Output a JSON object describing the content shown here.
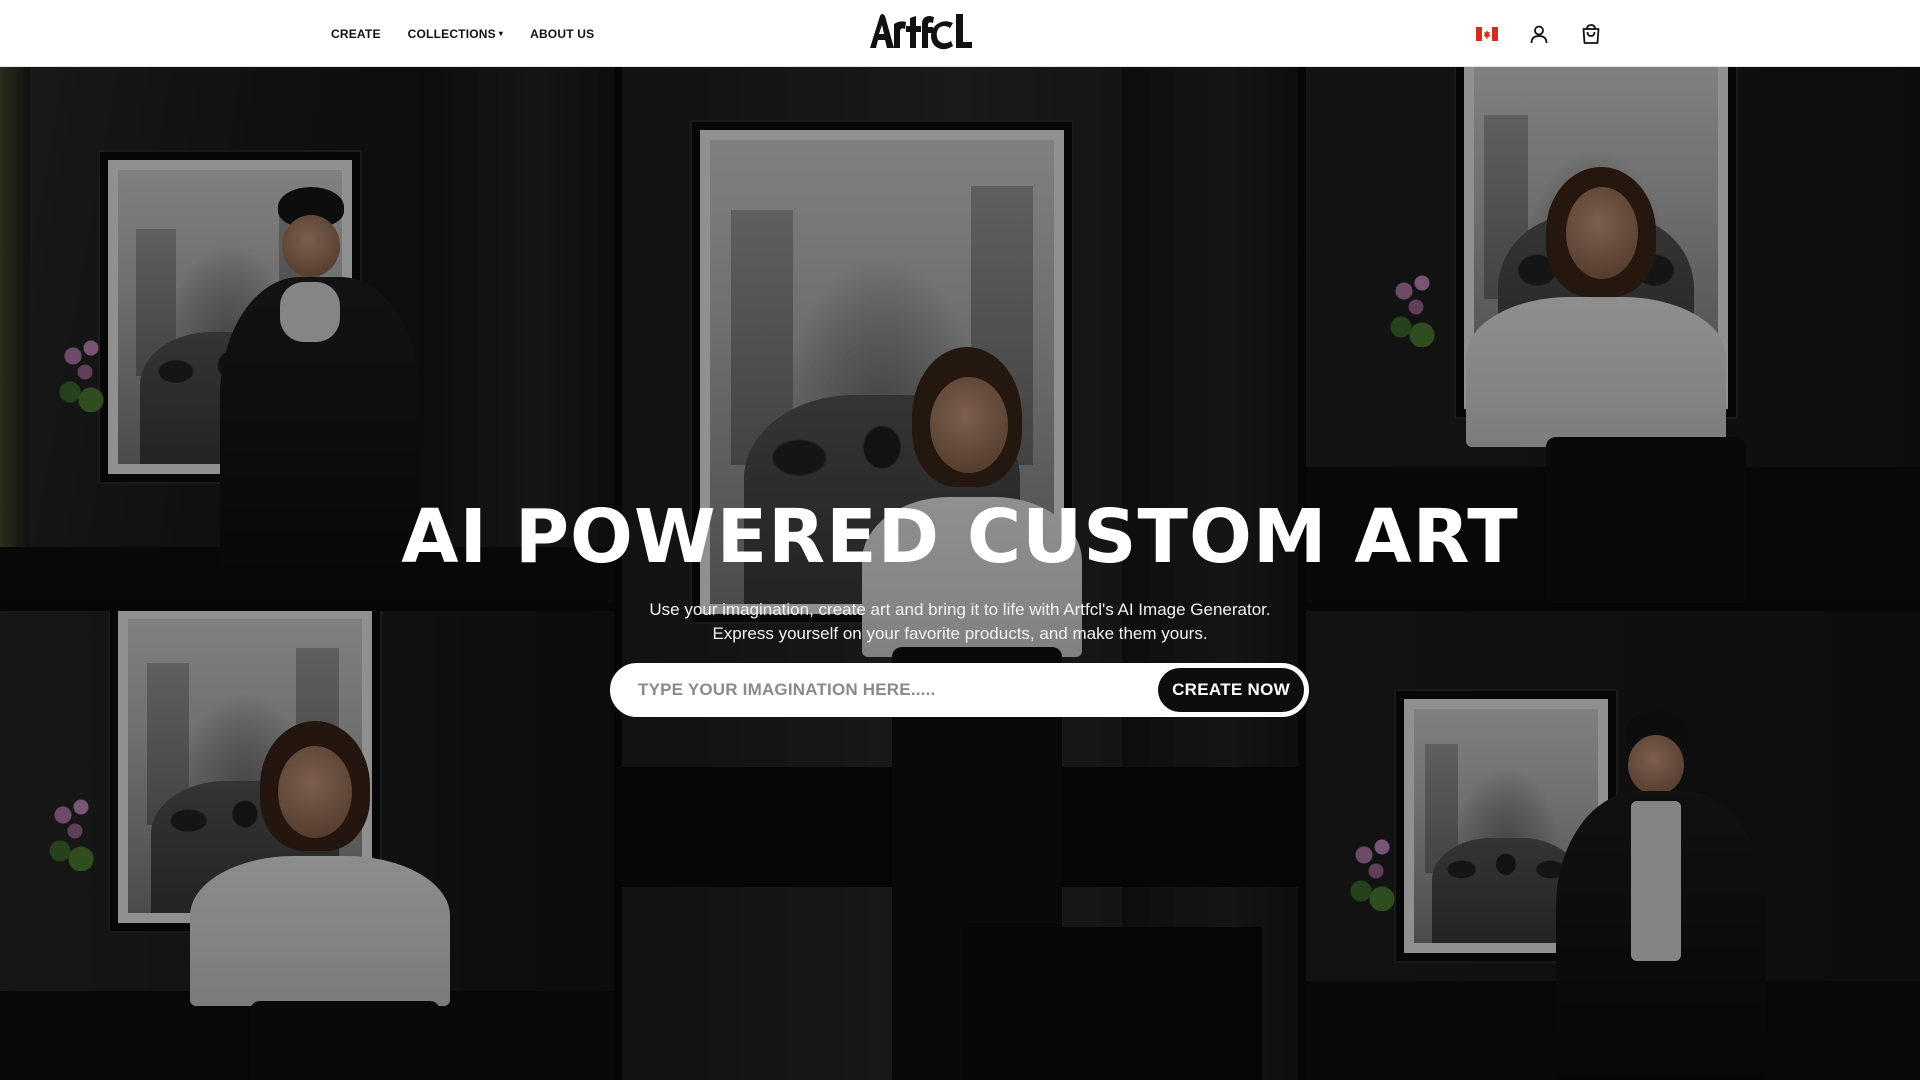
{
  "header": {
    "nav": [
      {
        "label": "CREATE",
        "has_dropdown": false
      },
      {
        "label": "COLLECTIONS",
        "has_dropdown": true
      },
      {
        "label": "ABOUT US",
        "has_dropdown": false
      }
    ],
    "logo_text": "Artfcl",
    "icons": [
      "canada-flag-icon",
      "account-icon",
      "cart-icon"
    ]
  },
  "hero": {
    "headline": "AI POWERED CUSTOM ART",
    "subtitle_line1": "Use your imagination, create art and bring it to life with Artfcl's AI Image Generator.",
    "subtitle_line2": "Express yourself on your favorite products, and make them yours.",
    "search": {
      "placeholder": "TYPE YOUR IMAGINATION HERE.....",
      "value": ""
    },
    "cta_label": "CREATE NOW"
  },
  "colors": {
    "header_bg": "#ffffff",
    "text_dark": "#111111",
    "cta_bg": "#0d0d0d",
    "flag_red": "#d52b1e"
  }
}
